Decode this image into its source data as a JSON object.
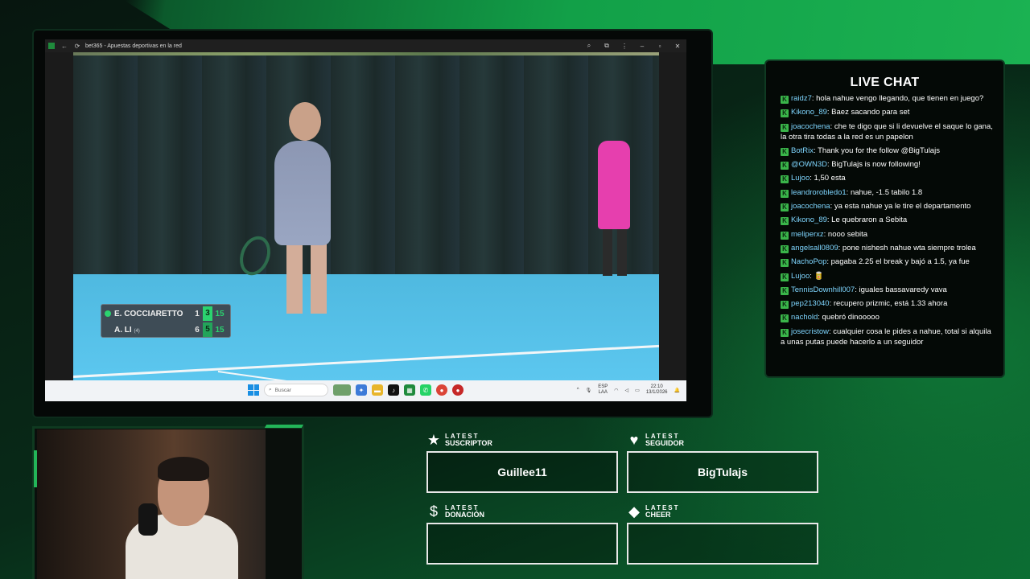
{
  "browser": {
    "title": "bet365 - Apuestas deportivas en la red"
  },
  "scoreboard": {
    "players": [
      {
        "name": "E. COCCIARETTO",
        "seed": "",
        "sets": "1",
        "games": "3",
        "points": "15"
      },
      {
        "name": "A. LI",
        "seed": "(4)",
        "sets": "6",
        "games": "5",
        "points": "15"
      }
    ]
  },
  "taskbar": {
    "search_placeholder": "Buscar",
    "lang_top": "ESP",
    "lang_bottom": "LAA",
    "time": "22:10",
    "date": "13/1/2026"
  },
  "chat": {
    "title": "LIVE CHAT",
    "messages": [
      {
        "user": "raidz7",
        "text": ": hola nahue vengo llegando, que tienen en juego?"
      },
      {
        "user": "Kikono_89",
        "text": ": Baez sacando para set"
      },
      {
        "user": "joacochena",
        "text": ": che te digo que si li devuelve el saque lo gana, la otra tira todas a la red es un papelon"
      },
      {
        "user": "BotRix",
        "text": ": Thank you for the follow @BigTulajs"
      },
      {
        "user": "@OWN3D",
        "text": ": BigTulajs is now following!"
      },
      {
        "user": "Lujoo",
        "text": ": 1,50 esta"
      },
      {
        "user": "leandrorobledo1",
        "text": ": nahue, -1.5 tabilo 1.8"
      },
      {
        "user": "joacochena",
        "text": ": ya esta nahue ya le tire el departamento"
      },
      {
        "user": "Kikono_89",
        "text": ": Le quebraron a Sebita"
      },
      {
        "user": "meliperxz",
        "text": ": nooo sebita"
      },
      {
        "user": "angelsall0809",
        "text": ": pone nishesh nahue wta siempre trolea"
      },
      {
        "user": "NachoPop",
        "text": ": pagaba 2.25 el break y bajó a 1.5, ya fue"
      },
      {
        "user": "Lujoo",
        "text": ": 🥫"
      },
      {
        "user": "TennisDownhill007",
        "text": ": iguales bassavaredy vava"
      },
      {
        "user": "pep213040",
        "text": ": recupero prizmic, está 1.33 ahora"
      },
      {
        "user": "nachold",
        "text": ": quebró dinooooo"
      },
      {
        "user": "josecristow",
        "text": ": cualquier cosa le pides a nahue, total si alquila a unas putas puede hacerlo a un seguidor"
      }
    ]
  },
  "stats": {
    "subscriber": {
      "label_top": "LATEST",
      "label_bottom": "SUSCRIPTOR",
      "value": "Guillee11",
      "icon": "star-icon"
    },
    "follower": {
      "label_top": "LATEST",
      "label_bottom": "SEGUIDOR",
      "value": "BigTulajs",
      "icon": "heart-icon"
    },
    "donation": {
      "label_top": "LATEST",
      "label_bottom": "DONACIÓN",
      "value": "",
      "icon": "dollar-icon"
    },
    "cheer": {
      "label_top": "LATEST",
      "label_bottom": "CHEER",
      "value": "",
      "icon": "diamond-icon"
    }
  },
  "colors": {
    "accent": "#1bb252",
    "chat_user": "#7fd6ff",
    "score_highlight": "#2bd36f"
  }
}
